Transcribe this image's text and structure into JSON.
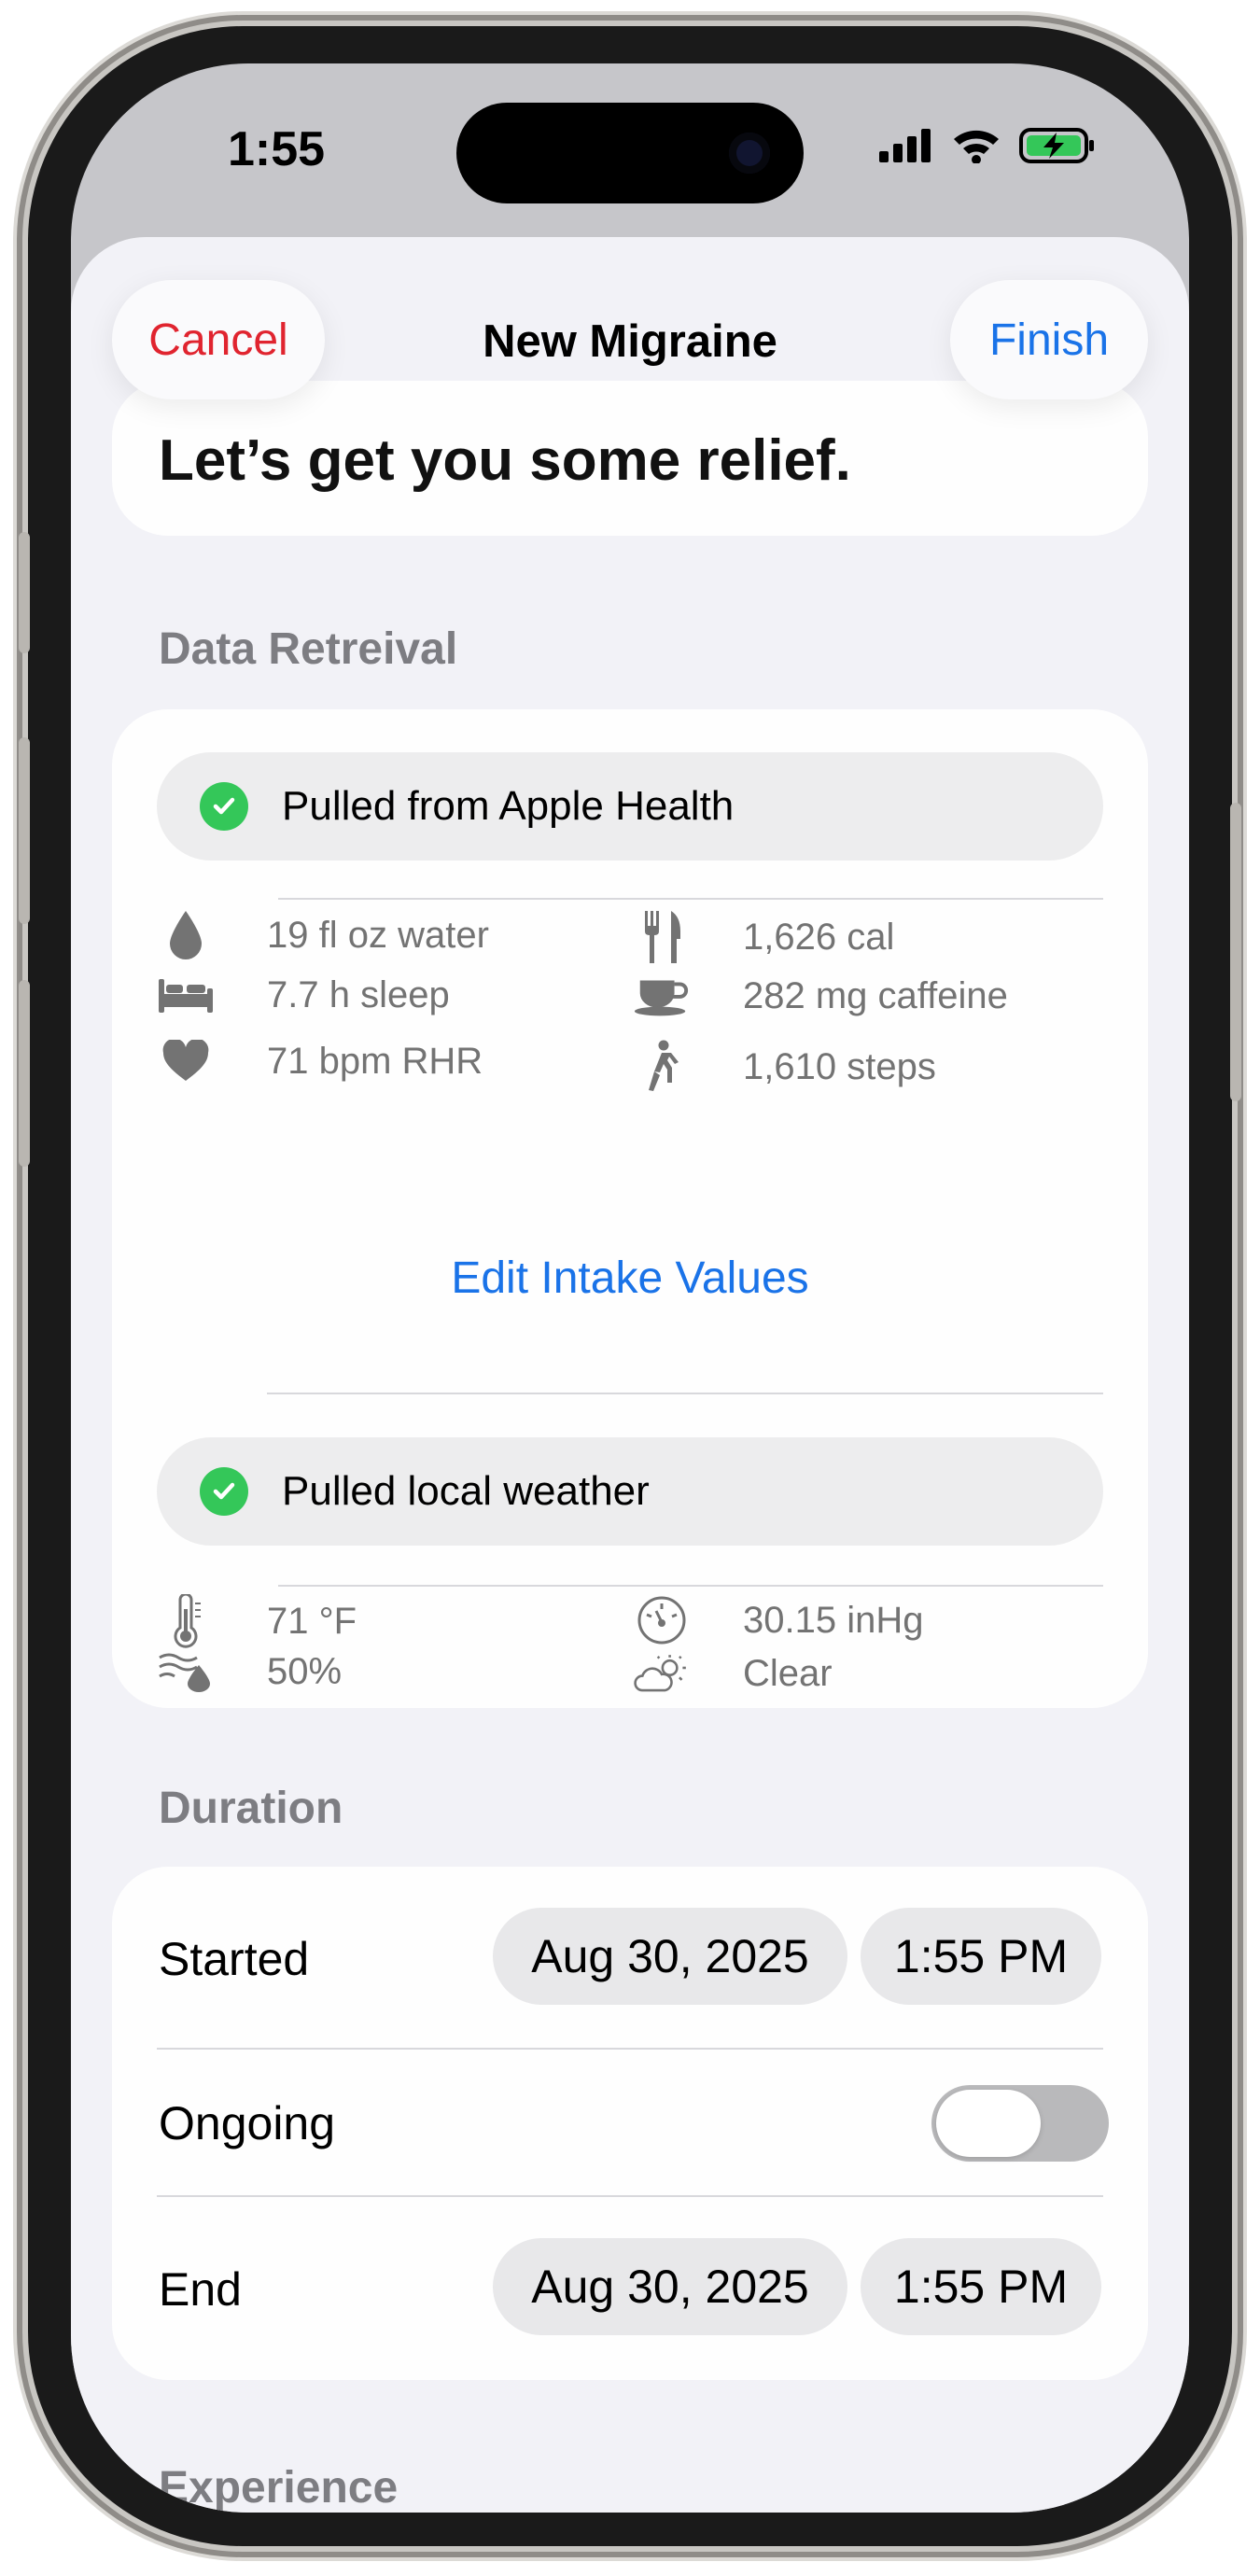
{
  "status_bar": {
    "time": "1:55"
  },
  "nav": {
    "cancel": "Cancel",
    "title": "New Migraine",
    "finish": "Finish"
  },
  "hero": {
    "text": "Let’s get you some relief."
  },
  "data_retrieval": {
    "header": "Data Retreival",
    "health_status": "Pulled from Apple Health",
    "health_stats": [
      {
        "icon": "water-drop-icon",
        "text": "19 fl oz water"
      },
      {
        "icon": "bed-icon",
        "text": "7.7 h sleep"
      },
      {
        "icon": "heart-icon",
        "text": "71 bpm RHR"
      },
      {
        "icon": "fork-knife-icon",
        "text": "1,626 cal"
      },
      {
        "icon": "cup-icon",
        "text": "282 mg caffeine"
      },
      {
        "icon": "walking-figure-icon",
        "text": "1,610 steps"
      }
    ],
    "edit_link": "Edit Intake Values",
    "weather_status": "Pulled local weather",
    "weather_stats": [
      {
        "icon": "thermometer-icon",
        "text": "71 °F"
      },
      {
        "icon": "humidity-icon",
        "text": "50%"
      },
      {
        "icon": "gauge-icon",
        "text": "30.15 inHg"
      },
      {
        "icon": "cloud-sun-icon",
        "text": "Clear"
      }
    ]
  },
  "duration": {
    "header": "Duration",
    "started_label": "Started",
    "started_date": "Aug 30, 2025",
    "started_time": "1:55 PM",
    "ongoing_label": "Ongoing",
    "ongoing_on": false,
    "end_label": "End",
    "end_date": "Aug 30, 2025",
    "end_time": "1:55 PM"
  },
  "experience": {
    "header": "Experience"
  },
  "colors": {
    "accent": "#1a73e8",
    "cancel": "#e0242f",
    "success": "#34c759"
  }
}
